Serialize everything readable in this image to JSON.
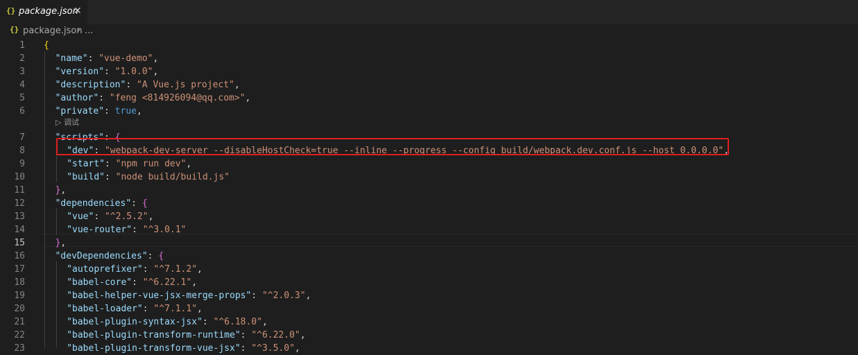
{
  "tab": {
    "icon": "{}",
    "title": "package.json",
    "close": "✕"
  },
  "breadcrumb": {
    "icon": "{}",
    "file": "package.json",
    "separator": "›",
    "ellipsis": "..."
  },
  "codelens": "▷ 调试",
  "editor": {
    "active_line": 15,
    "lines": [
      {
        "num": "1",
        "text": "{"
      },
      {
        "num": "2",
        "text": "\"name\": \"vue-demo\","
      },
      {
        "num": "3",
        "text": "\"version\": \"1.0.0\","
      },
      {
        "num": "4",
        "text": "\"description\": \"A Vue.js project\","
      },
      {
        "num": "5",
        "text": "\"author\": \"feng <814926094@qq.com>\","
      },
      {
        "num": "6",
        "text": "\"private\": true,"
      },
      {
        "num": "7",
        "text": "\"scripts\": {"
      },
      {
        "num": "8",
        "text": "\"dev\": \"webpack-dev-server --disableHostCheck=true --inline --progress --config build/webpack.dev.conf.js --host 0.0.0.0\","
      },
      {
        "num": "9",
        "text": "\"start\": \"npm run dev\","
      },
      {
        "num": "10",
        "text": "\"build\": \"node build/build.js\""
      },
      {
        "num": "11",
        "text": "},"
      },
      {
        "num": "12",
        "text": "\"dependencies\": {"
      },
      {
        "num": "13",
        "text": "\"vue\": \"^2.5.2\","
      },
      {
        "num": "14",
        "text": "\"vue-router\": \"^3.0.1\""
      },
      {
        "num": "15",
        "text": "},"
      },
      {
        "num": "16",
        "text": "\"devDependencies\": {"
      },
      {
        "num": "17",
        "text": "\"autoprefixer\": \"^7.1.2\","
      },
      {
        "num": "18",
        "text": "\"babel-core\": \"^6.22.1\","
      },
      {
        "num": "19",
        "text": "\"babel-helper-vue-jsx-merge-props\": \"^2.0.3\","
      },
      {
        "num": "20",
        "text": "\"babel-loader\": \"^7.1.1\","
      },
      {
        "num": "21",
        "text": "\"babel-plugin-syntax-jsx\": \"^6.18.0\","
      },
      {
        "num": "22",
        "text": "\"babel-plugin-transform-runtime\": \"^6.22.0\","
      },
      {
        "num": "23",
        "text": "\"babel-plugin-transform-vue-jsx\": \"^3.5.0\","
      }
    ]
  },
  "colors": {
    "background": "#1e1e1e",
    "key": "#9cdcfe",
    "string": "#ce9178",
    "highlight_box": "#e01f1f"
  }
}
